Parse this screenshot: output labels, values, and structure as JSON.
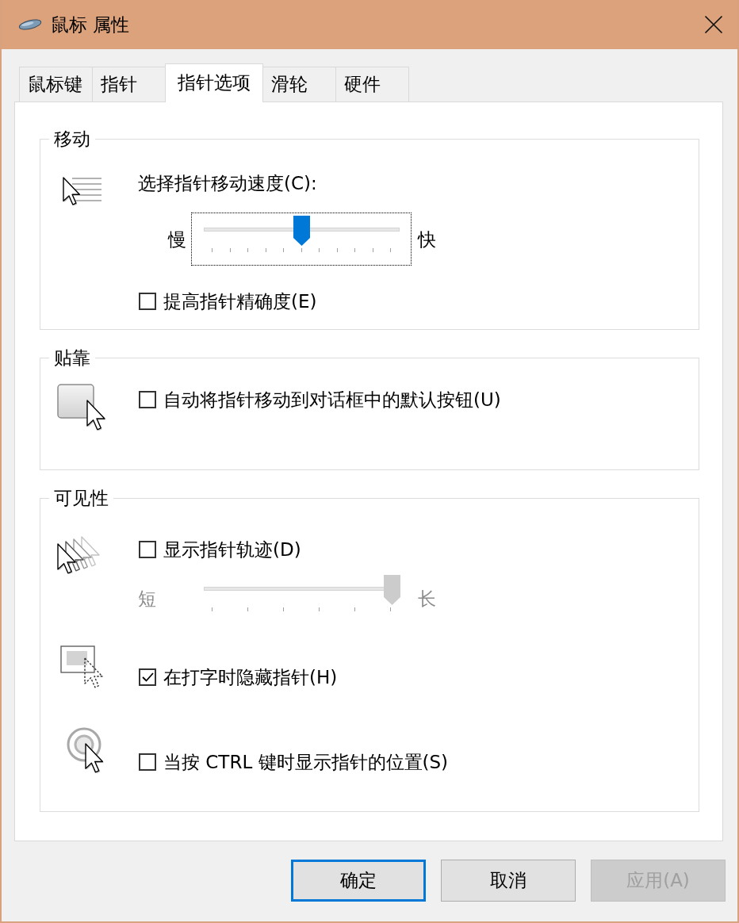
{
  "window": {
    "title": "鼠标 属性"
  },
  "tabs": [
    {
      "label": "鼠标键",
      "selected": false
    },
    {
      "label": "指针",
      "selected": false
    },
    {
      "label": "指针选项",
      "selected": true
    },
    {
      "label": "滑轮",
      "selected": false
    },
    {
      "label": "硬件",
      "selected": false
    }
  ],
  "motion": {
    "title": "移动",
    "speed_label": "选择指针移动速度(C):",
    "speed_slider": {
      "min_label": "慢",
      "max_label": "快",
      "level": 0.5,
      "focused": true,
      "disabled": false
    },
    "precision": {
      "label": "提高指针精确度(E)",
      "checked": false
    }
  },
  "snap_to": {
    "title": "贴靠",
    "default_button": {
      "label": "自动将指针移动到对话框中的默认按钮(U)",
      "checked": false
    }
  },
  "visibility": {
    "title": "可见性",
    "trails": {
      "label": "显示指针轨迹(D)",
      "checked": false
    },
    "trail_slider": {
      "min_label": "短",
      "max_label": "长",
      "level": 1,
      "disabled": true
    },
    "hide_while_typing": {
      "label": "在打字时隐藏指针(H)",
      "checked": true
    },
    "show_location": {
      "label": "当按 CTRL 键时显示指针的位置(S)",
      "checked": false
    }
  },
  "buttons": [
    {
      "label": "确定",
      "default": true,
      "disabled": false
    },
    {
      "label": "取消",
      "default": false,
      "disabled": false
    },
    {
      "label": "应用(A)",
      "default": false,
      "disabled": true
    }
  ]
}
